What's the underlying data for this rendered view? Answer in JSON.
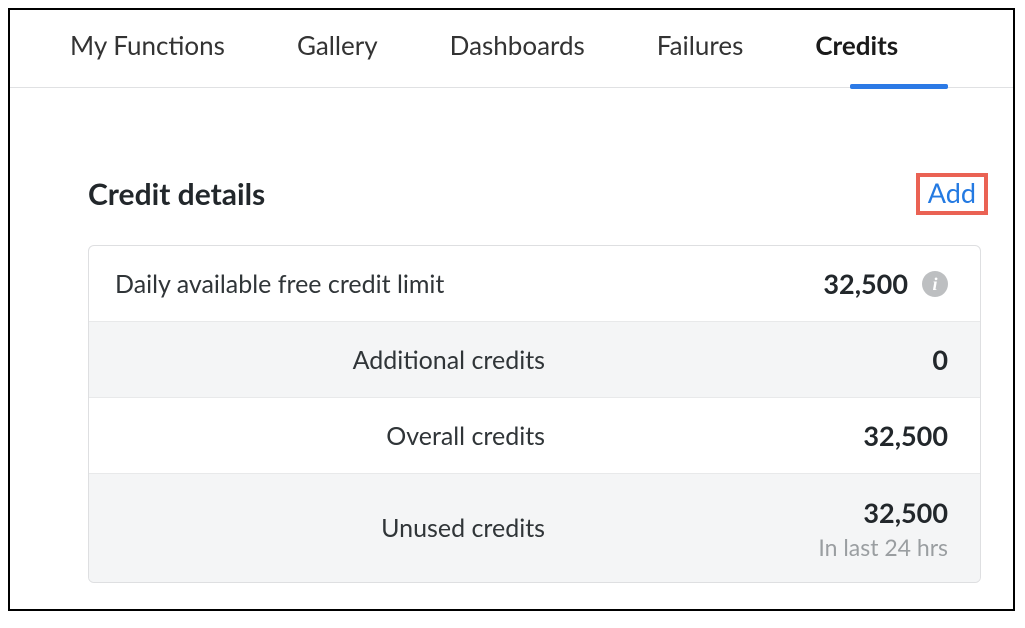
{
  "tabs": {
    "items": [
      {
        "label": "My Functions"
      },
      {
        "label": "Gallery"
      },
      {
        "label": "Dashboards"
      },
      {
        "label": "Failures"
      },
      {
        "label": "Credits"
      }
    ],
    "active_index": 4
  },
  "section": {
    "title": "Credit details",
    "add_label": "Add"
  },
  "credits": {
    "rows": [
      {
        "label": "Daily available free credit limit",
        "value": "32,500",
        "has_info": true
      },
      {
        "label": "Additional credits",
        "value": "0",
        "has_info": false
      },
      {
        "label": "Overall credits",
        "value": "32,500",
        "has_info": false
      },
      {
        "label": "Unused credits",
        "value": "32,500",
        "has_info": false,
        "caption": "In last 24 hrs"
      }
    ]
  },
  "icons": {
    "info_glyph": "i"
  }
}
